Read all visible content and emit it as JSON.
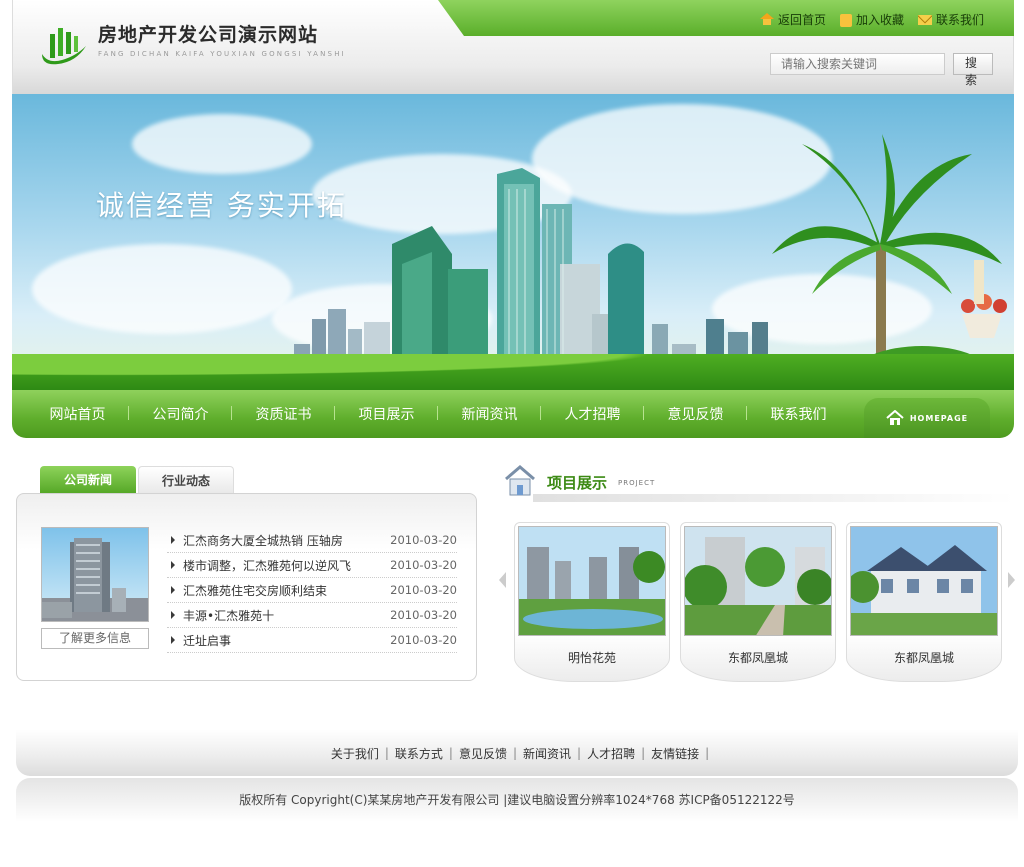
{
  "site": {
    "title": "房地产开发公司演示网站",
    "subtitle": "FANG DICHAN KAIFA YOUXIAN GONGSI YANSHI"
  },
  "toplinks": [
    {
      "label": "返回首页",
      "icon": "home-icon"
    },
    {
      "label": "加入收藏",
      "icon": "lock-icon"
    },
    {
      "label": "联系我们",
      "icon": "mail-icon"
    }
  ],
  "search": {
    "placeholder": "请输入搜索关键词",
    "button": "搜 索"
  },
  "banner": {
    "slogan": "诚信经营  务实开拓"
  },
  "nav": {
    "items": [
      "网站首页",
      "公司简介",
      "资质证书",
      "项目展示",
      "新闻资讯",
      "人才招聘",
      "意见反馈",
      "联系我们"
    ],
    "homepage_label": "HOMEPAGE"
  },
  "news": {
    "tabs": [
      "公司新闻",
      "行业动态"
    ],
    "more": "了解更多信息",
    "items": [
      {
        "title": "汇杰商务大厦全城热销 压轴房",
        "date": "2010-03-20"
      },
      {
        "title": "楼市调整，汇杰雅苑何以逆风飞",
        "date": "2010-03-20"
      },
      {
        "title": "汇杰雅苑住宅交房顺利结束",
        "date": "2010-03-20"
      },
      {
        "title": "丰源•汇杰雅苑十",
        "date": "2010-03-20"
      },
      {
        "title": "迁址启事",
        "date": "2010-03-20"
      }
    ]
  },
  "projects": {
    "title": "项目展示",
    "subtitle": "PROJECT",
    "items": [
      "明怡花苑",
      "东都凤凰城",
      "东都凤凰城"
    ]
  },
  "footer": {
    "links": [
      "关于我们",
      "联系方式",
      "意见反馈",
      "新闻资讯",
      "人才招聘",
      "友情链接"
    ],
    "copyright": "版权所有  Copyright(C)某某房地产开发有限公司  |建议电脑设置分辨率1024*768 苏ICP备05122122号"
  },
  "colors": {
    "accent": "#5fae2c",
    "accent_light": "#8fd35e",
    "title_green": "#3c8a14"
  }
}
